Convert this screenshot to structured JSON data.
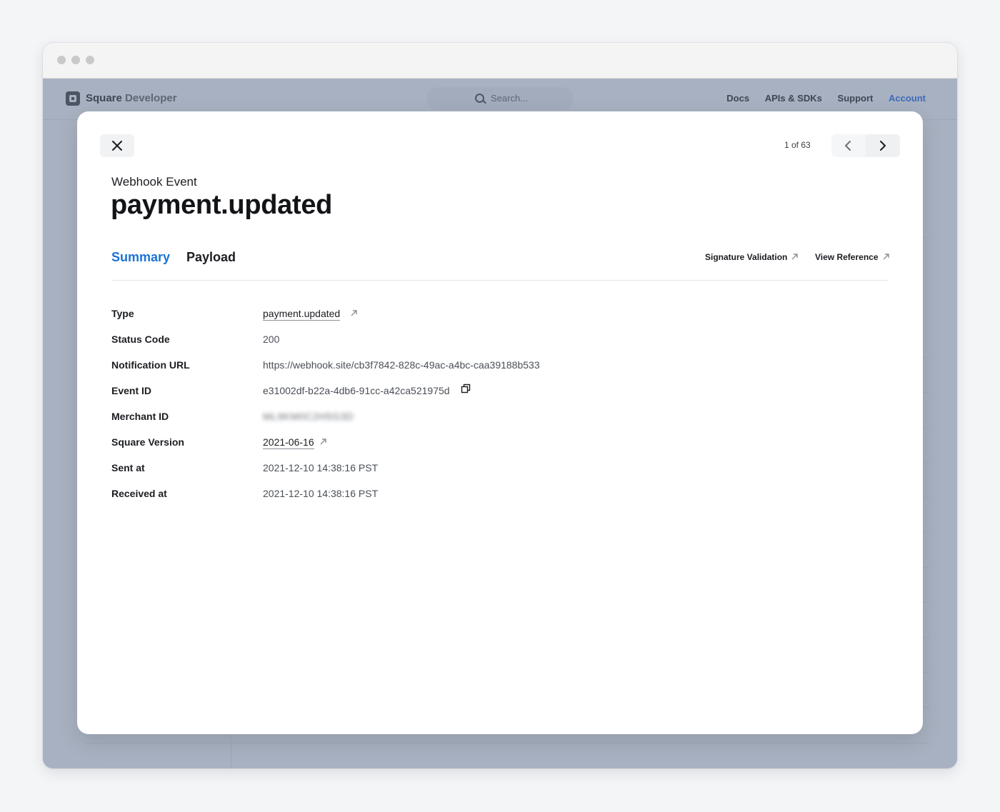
{
  "background": {
    "brand": "Square",
    "brand_suffix": "Developer",
    "search_placeholder": "Search...",
    "nav": [
      "Docs",
      "APIs & SDKs",
      "Support",
      "Account"
    ]
  },
  "modal": {
    "pager_count": "1 of 63",
    "eyebrow": "Webhook Event",
    "title": "payment.updated",
    "tabs": [
      {
        "label": "Summary",
        "active": true
      },
      {
        "label": "Payload",
        "active": false
      }
    ],
    "links": {
      "signature_validation": "Signature Validation",
      "view_reference": "View Reference"
    },
    "fields": [
      {
        "label": "Type",
        "value": "payment.updated"
      },
      {
        "label": "Status Code",
        "value": "200"
      },
      {
        "label": "Notification URL",
        "value": "https://webhook.site/cb3f7842-828c-49ac-a4bc-caa39188b533"
      },
      {
        "label": "Event ID",
        "value": "e31002df-b22a-4db6-91cc-a42ca521975d"
      },
      {
        "label": "Merchant ID",
        "value": "ML9KM0C2H5G3D"
      },
      {
        "label": "Square Version",
        "value": "2021-06-16"
      },
      {
        "label": "Sent at",
        "value": "2021-12-10 14:38:16 PST"
      },
      {
        "label": "Received at",
        "value": "2021-12-10 14:38:16 PST"
      }
    ]
  },
  "colors": {
    "accent": "#1a73d6",
    "overlay": "#a8b1c1"
  },
  "icons": [
    "close-icon",
    "chevron-left-icon",
    "chevron-right-icon",
    "external-arrow-icon",
    "copy-icon",
    "search-icon"
  ]
}
